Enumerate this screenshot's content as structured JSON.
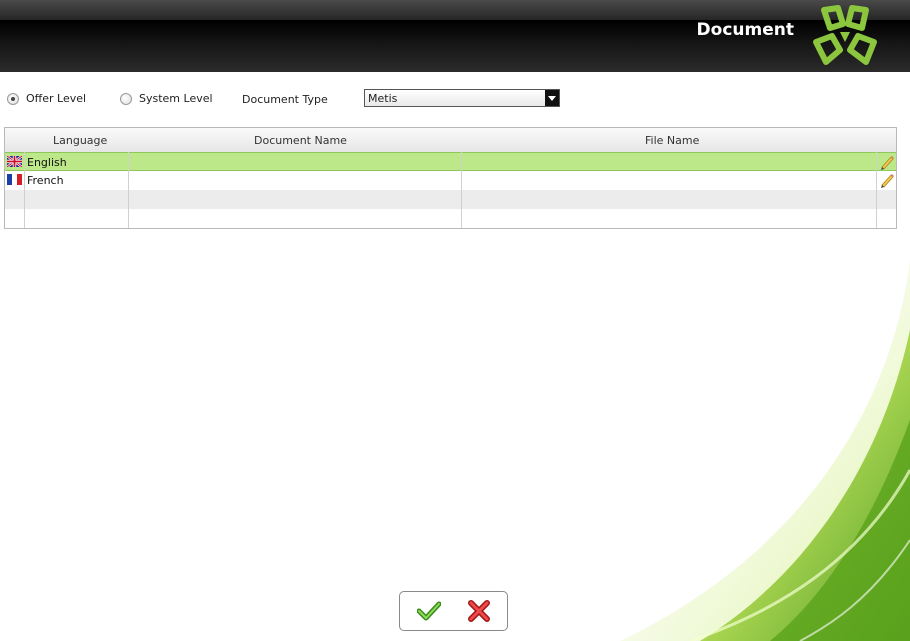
{
  "header": {
    "title": "Document",
    "logo_icon": "clover-logo-icon"
  },
  "toolbar": {
    "offer_level_label": "Offer Level",
    "offer_level_selected": true,
    "system_level_label": "System Level",
    "system_level_selected": false,
    "document_type_label": "Document Type",
    "document_type_value": "Metis"
  },
  "grid": {
    "columns": [
      "Language",
      "Document Name",
      "File Name"
    ],
    "rows": [
      {
        "flag_icon": "uk-flag-icon",
        "language": "English",
        "document_name": "",
        "file_name": "",
        "selected": true
      },
      {
        "flag_icon": "france-flag-icon",
        "language": "French",
        "document_name": "",
        "file_name": "",
        "selected": false
      }
    ]
  },
  "actions": {
    "ok_icon": "checkmark-icon",
    "cancel_icon": "close-icon"
  },
  "colors": {
    "selected_row": "#bde88a",
    "accent_green": "#8cc63f",
    "header_dark": "#111111"
  }
}
